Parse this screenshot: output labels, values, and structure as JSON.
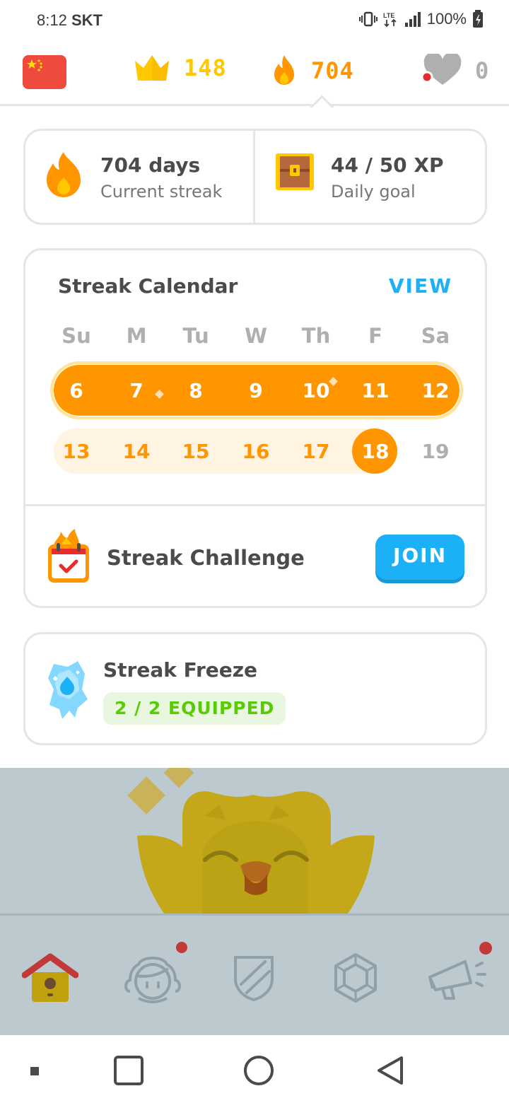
{
  "status_bar": {
    "time": "8:12",
    "carrier": "SKT",
    "battery": "100%",
    "network": "LTE"
  },
  "top_bar": {
    "flag": "china-flag",
    "crowns": "148",
    "streak": "704",
    "hearts": "0",
    "colors": {
      "crown": "#ffc800",
      "streak": "#ff9600",
      "hearts": "#afafaf"
    }
  },
  "summary": {
    "streak_title": "704 days",
    "streak_subtitle": "Current streak",
    "goal_title": "44 / 50 XP",
    "goal_subtitle": "Daily goal"
  },
  "calendar": {
    "title": "Streak Calendar",
    "view_label": "VIEW",
    "weekdays": [
      "Su",
      "M",
      "Tu",
      "W",
      "Th",
      "F",
      "Sa"
    ],
    "week1": [
      "6",
      "7",
      "8",
      "9",
      "10",
      "11",
      "12"
    ],
    "week2": [
      "13",
      "14",
      "15",
      "16",
      "17",
      "18",
      "19"
    ],
    "today": "18"
  },
  "challenge": {
    "label": "Streak Challenge",
    "join_label": "JOIN"
  },
  "freeze": {
    "title": "Streak Freeze",
    "badge": "2 / 2 EQUIPPED"
  },
  "bottom_nav": {
    "items": [
      "home",
      "profile",
      "leagues",
      "shop",
      "news"
    ],
    "notification_items": [
      "profile",
      "news"
    ]
  },
  "colors": {
    "accent_orange": "#ff9600",
    "accent_blue": "#1cb0f6",
    "accent_green": "#58cc02"
  }
}
